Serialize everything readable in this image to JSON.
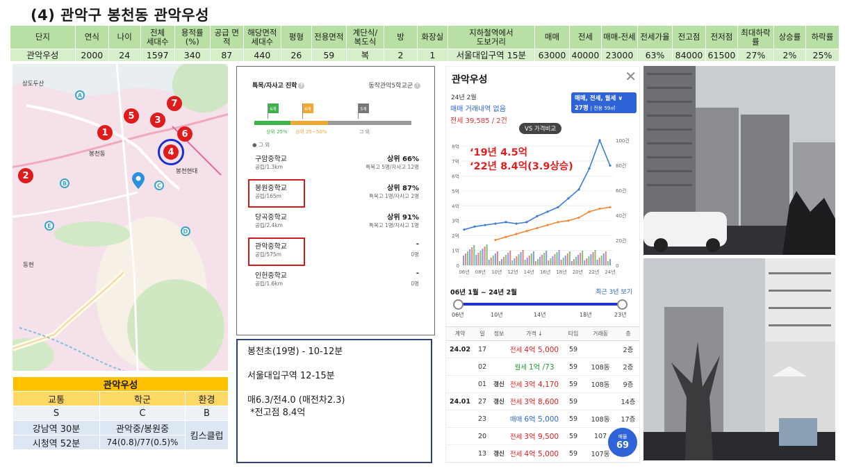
{
  "page": {
    "title": "(4) 관악구 봉천동 관악우성"
  },
  "top_table": {
    "headers": [
      "단지",
      "연식",
      "나이",
      "전체\n세대수",
      "용적률\n(%)",
      "공급 면적",
      "해당면적\n세대수",
      "평형",
      "전용면적",
      "계단식/\n복도식",
      "방",
      "화장실",
      "지하철역에서\n도보거리",
      "매매",
      "전세",
      "매매-전세",
      "전세가율",
      "전고점",
      "전저점",
      "최대하락\n률",
      "상승률",
      "하락률"
    ],
    "row": [
      "관악우성",
      "2000",
      "24",
      "1597",
      "340",
      "87",
      "440",
      "26",
      "59",
      "복",
      "2",
      "1",
      "서울대입구역 15분",
      "63000",
      "40000",
      "23000",
      "63%",
      "84000",
      "61500",
      "27%",
      "2%",
      "25%"
    ]
  },
  "map": {
    "labels": [
      "봉천동",
      "상도두산",
      "동현",
      "봉천현대"
    ],
    "markers": [
      "1",
      "2",
      "3",
      "4",
      "5",
      "6",
      "7"
    ],
    "pins": [
      "A",
      "B",
      "C",
      "D",
      "E"
    ]
  },
  "summary": {
    "title": "관악우성",
    "headers": [
      "교통",
      "학군",
      "환경"
    ],
    "grades": [
      "S",
      "C",
      "B"
    ],
    "row1": [
      "강남역 30분",
      "관악중/봉원중",
      "킴스클럽"
    ],
    "row2": [
      "시청역 52분",
      "74(0.8)/77(0.5)%"
    ]
  },
  "school": {
    "head_left": "특목/자사고 진학",
    "head_right": "동작관악5학교군",
    "flags": [
      "6개",
      "6개",
      "5개"
    ],
    "flag_labels": [
      "상위 25%",
      "상위 25~50%",
      "그 외"
    ],
    "grade_label": "그 외",
    "rows": [
      {
        "name": "구암중학교",
        "sub": "공립/1.3km",
        "rank": "상위 66%",
        "detail": "특목고 5명/자사고 12명"
      },
      {
        "name": "봉원중학교",
        "sub": "공립/165m",
        "rank": "상위 87%",
        "detail": "특목고 1명/자사고 2명"
      },
      {
        "name": "당곡중학교",
        "sub": "공립/2.4km",
        "rank": "상위 91%",
        "detail": "특목고 1명/자사고 1명"
      },
      {
        "name": "관악중학교",
        "sub": "공립/575m",
        "rank": "-",
        "detail": "0명"
      },
      {
        "name": "인헌중학교",
        "sub": "공립/1.6km",
        "rank": "-",
        "detail": "0명"
      }
    ]
  },
  "note": {
    "line1": "봉천초(19명) - 10-12분",
    "line2": "서울대입구역 12-15분",
    "line3": "매6.3/전4.0 (매전차2.3)",
    "line4": " *전고점 8.4억"
  },
  "price": {
    "title": "관악우성",
    "close": "✕",
    "date": "24년 2월",
    "no_sale": "매매 거래내역 없음",
    "jeonse": "전세 39,585 / 2건",
    "badge_line1": "매매, 전세, 월세 ∨",
    "badge_count": "27평",
    "badge_area": "| 전용 59㎡",
    "vs": "VS 가격비교",
    "annot1": "‘19년 4.5억",
    "annot2": "‘22년 8.4억(3.9상승)",
    "range": "06년 1월 ~ 24년 2월",
    "recent": "최근 3년 보기",
    "slider_years": [
      "06년",
      "10년",
      "14년",
      "18년",
      "23년"
    ],
    "table_headers": [
      "계약",
      "일",
      "정보",
      "가격 ↓",
      "타입",
      "거래동",
      "층"
    ],
    "rows": [
      {
        "month": "24.02",
        "day": "17",
        "info": "",
        "kind": "전세",
        "price": "4억 5,000",
        "type": "59",
        "dong": "",
        "floor": "2층"
      },
      {
        "month": "",
        "day": "02",
        "info": "",
        "kind": "월세",
        "price": "1억 /73",
        "type": "59",
        "dong": "108동",
        "floor": "2층"
      },
      {
        "month": "",
        "day": "01",
        "info": "갱신",
        "kind": "전세",
        "price": "3억 4,170",
        "type": "59",
        "dong": "108동",
        "floor": "9층"
      },
      {
        "month": "24.01",
        "day": "27",
        "info": "갱신",
        "kind": "전세",
        "price": "3억 8,600",
        "type": "59",
        "dong": "",
        "floor": "14층"
      },
      {
        "month": "",
        "day": "23",
        "info": "",
        "kind": "매매",
        "price": "6억 5,000",
        "type": "59",
        "dong": "108동",
        "floor": "17층"
      },
      {
        "month": "",
        "day": "20",
        "info": "",
        "kind": "전세",
        "price": "3억 9,500",
        "type": "59",
        "dong": "107",
        "floor": ""
      },
      {
        "month": "",
        "day": "13",
        "info": "갱신",
        "kind": "전세",
        "price": "4억 5,000",
        "type": "59",
        "dong": "107동",
        "floor": ""
      }
    ],
    "fab_label": "매물",
    "fab_count": "69"
  },
  "chart_data": {
    "type": "line",
    "title": "",
    "x": [
      "06년",
      "08년",
      "10년",
      "12년",
      "14년",
      "16년",
      "18년",
      "20년",
      "22년",
      "24년"
    ],
    "y_left_ticks": [
      "0",
      "1억",
      "2억",
      "3억",
      "4억",
      "5억",
      "6억",
      "7억",
      "8억"
    ],
    "y_right_ticks": [
      "0",
      "20건",
      "40건",
      "60건",
      "80건",
      "100건"
    ],
    "ylim_left": [
      0,
      8.4
    ],
    "ylim_right": [
      0,
      100
    ],
    "series": [
      {
        "values": [
          2.4,
          2.6,
          2.7,
          2.8,
          2.9,
          2.8,
          2.9,
          3.3,
          3.6,
          3.9,
          4.5,
          5.1,
          6.5,
          8.4,
          6.7
        ]
      },
      {
        "values": [
          null,
          null,
          null,
          1.7,
          1.9,
          2.1,
          2.3,
          2.5,
          2.7,
          2.9,
          3.0,
          3.2,
          3.6,
          3.8,
          3.9
        ]
      }
    ],
    "colors": {
      "sale": "#3b7ddd",
      "jeonse": "#f0893a",
      "volume_blue": "#5577e0",
      "volume_red": "#e05555",
      "volume_green": "#4caf50"
    },
    "grid": true
  }
}
